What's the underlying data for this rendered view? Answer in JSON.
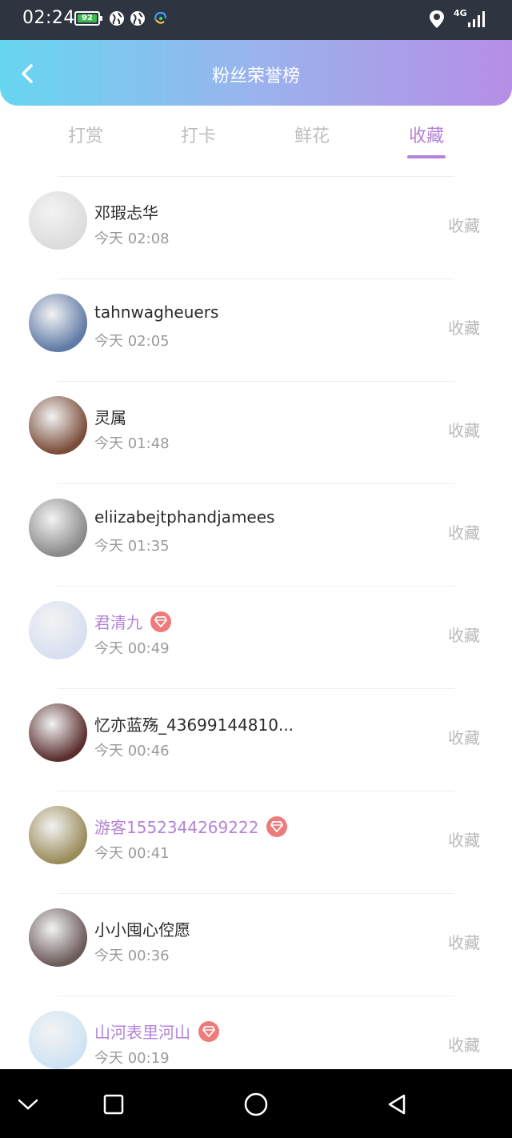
{
  "status_bar": {
    "time": "02:24",
    "battery": "92",
    "network": "4G",
    "icons": [
      "battery-icon",
      "globe-icon",
      "globe-icon",
      "headset-icon",
      "location-pin-icon",
      "signal-icon"
    ]
  },
  "header": {
    "title": "粉丝荣誉榜",
    "back_icon": "chevron-left-icon"
  },
  "tabs": [
    {
      "label": "打赏",
      "active": false
    },
    {
      "label": "打卡",
      "active": false
    },
    {
      "label": "鲜花",
      "active": false
    },
    {
      "label": "收藏",
      "active": true
    }
  ],
  "colors": {
    "accent": "#b483d8",
    "vip_badge": "#ee7b7b",
    "header_gradient": [
      "#67d6f0",
      "#b68ee6"
    ]
  },
  "list": [
    {
      "name": "邓瑕忐华",
      "time": "今天 02:08",
      "vip": false,
      "action": "收藏",
      "avatar_color": "#dcdcdc"
    },
    {
      "name": "tahnwagheuers",
      "time": "今天 02:05",
      "vip": false,
      "action": "收藏",
      "avatar_color": "#5f7aa6"
    },
    {
      "name": "灵属",
      "time": "今天 01:48",
      "vip": false,
      "action": "收藏",
      "avatar_color": "#7a4d3a"
    },
    {
      "name": "eliizabejtphandjamees",
      "time": "今天 01:35",
      "vip": false,
      "action": "收藏",
      "avatar_color": "#8a8a8a"
    },
    {
      "name": "君清九",
      "time": "今天 00:49",
      "vip": true,
      "action": "收藏",
      "avatar_color": "#d7dff0"
    },
    {
      "name": "忆亦蓝殇_43699144810...",
      "time": "今天 00:46",
      "vip": false,
      "action": "收藏",
      "avatar_color": "#5a2e2e"
    },
    {
      "name": "游客1552344269222",
      "time": "今天 00:41",
      "vip": true,
      "action": "收藏",
      "avatar_color": "#9a8c5a"
    },
    {
      "name": "小小囤心倥愿",
      "time": "今天 00:36",
      "vip": false,
      "action": "收藏",
      "avatar_color": "#6b5a5a"
    },
    {
      "name": "山河表里河山",
      "time": "今天 00:19",
      "vip": true,
      "action": "收藏",
      "avatar_color": "#cfe3f3"
    }
  ],
  "nav_bar": {
    "icons": [
      "chevron-down-icon",
      "recents-square-icon",
      "home-circle-icon",
      "back-triangle-icon"
    ]
  }
}
